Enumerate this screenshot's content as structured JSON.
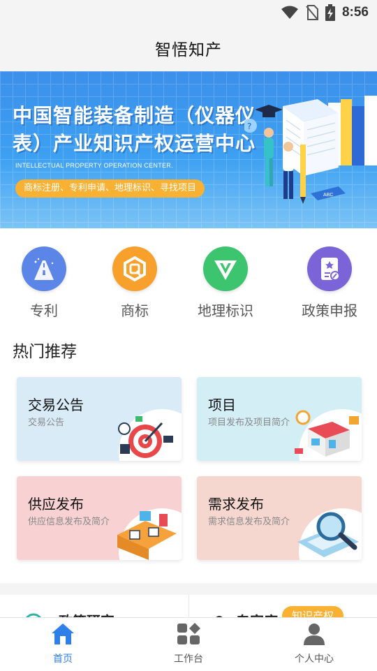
{
  "status": {
    "time": "8:56",
    "icons": [
      "wifi-icon",
      "no-sim-icon",
      "battery-charging-icon"
    ]
  },
  "header": {
    "title": "智悟知产"
  },
  "banner": {
    "line1": "中国智能装备制造（仪器仪",
    "line2": "表）产业知识产权运营中心",
    "english": "INTELLECTUAL PROPERTY OPERATION CENTER.",
    "pill": "商标注册、专利申请、地理标识、寻找项目"
  },
  "categories": [
    {
      "label": "专利",
      "icon": "patent-road-icon",
      "color": "#5b86e8"
    },
    {
      "label": "商标",
      "icon": "trademark-q-icon",
      "color": "#f7a02b"
    },
    {
      "label": "地理标识",
      "icon": "geo-mark-icon",
      "color": "#3cc46e"
    },
    {
      "label": "政策申报",
      "icon": "policy-document-icon",
      "color": "#7b63d8"
    }
  ],
  "hot": {
    "title": "热门推荐",
    "cards": [
      {
        "title": "交易公告",
        "subtitle": "交易公告",
        "bg": "#d8ebf7",
        "icon": "target-illustration-icon"
      },
      {
        "title": "项目",
        "subtitle": "项目发布及项目简介",
        "bg": "#d3eef5",
        "icon": "store-illustration-icon"
      },
      {
        "title": "供应发布",
        "subtitle": "供应信息发布及简介",
        "bg": "#f8d1d3",
        "icon": "office-illustration-icon"
      },
      {
        "title": "需求发布",
        "subtitle": "需求信息发布及简介",
        "bg": "#f6d7d0",
        "icon": "magnifier-illustration-icon"
      }
    ]
  },
  "peek": {
    "badge": "知识产权",
    "left_text": "政策研究",
    "right_text": "专家库"
  },
  "nav": [
    {
      "label": "首页",
      "icon": "home-icon",
      "active": true
    },
    {
      "label": "工作台",
      "icon": "workbench-grid-icon",
      "active": false
    },
    {
      "label": "个人中心",
      "icon": "person-icon",
      "active": false
    }
  ]
}
